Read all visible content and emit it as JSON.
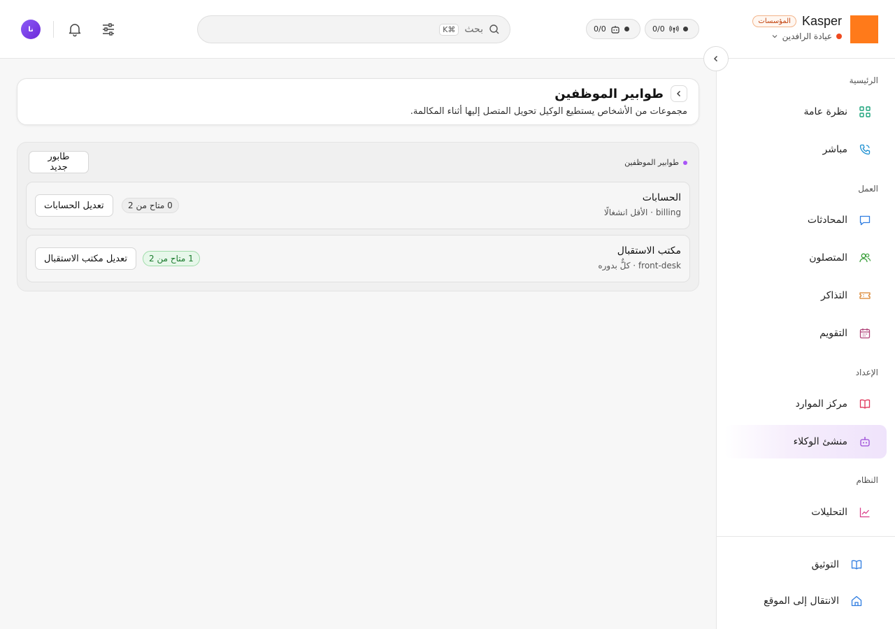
{
  "header": {
    "brand_name": "Kasper",
    "brand_badge": "المؤسسات",
    "workspace": "عيادة الرافدين",
    "pill_calls": "0/0",
    "pill_agents": "0/0",
    "search_placeholder": "بحث",
    "search_shortcut": "⌘K",
    "avatar_initials": "نا",
    "logo_color": "#ff7a1a"
  },
  "sidebar": {
    "sections": [
      {
        "label": "الرئيسية"
      },
      {
        "label": "العمل"
      },
      {
        "label": "الإعداد"
      },
      {
        "label": "النظام"
      }
    ],
    "items": [
      {
        "label": "نظرة عامة",
        "icon": "grid-icon"
      },
      {
        "label": "مباشر",
        "icon": "phone-icon"
      },
      {
        "label": "المحادثات",
        "icon": "chat-icon"
      },
      {
        "label": "المتصلون",
        "icon": "users-icon"
      },
      {
        "label": "التذاكر",
        "icon": "ticket-icon"
      },
      {
        "label": "التقويم",
        "icon": "calendar-icon"
      },
      {
        "label": "مركز الموارد",
        "icon": "book-icon"
      },
      {
        "label": "منشئ الوكلاء",
        "icon": "robot-icon",
        "active": true
      },
      {
        "label": "التحليلات",
        "icon": "chart-icon"
      }
    ],
    "footer": [
      {
        "label": "التوثيق",
        "icon": "docs-icon"
      },
      {
        "label": "الانتقال إلى الموقع",
        "icon": "home-icon"
      }
    ]
  },
  "page": {
    "title": "طوابير الموظفين",
    "description": "مجموعات من الأشخاص يستطيع الوكيل تحويل المتصل إليها أثناء المكالمة."
  },
  "queues": {
    "header_label": "طوابير الموظفين",
    "new_button": "طابور جديد",
    "rows": [
      {
        "name": "الحسابات",
        "slug": "billing",
        "strategy": "· الأقل انشغالًا",
        "capacity": "0 متاح من 2",
        "edit_label": "تعديل الحسابات",
        "status": "gray"
      },
      {
        "name": "مكتب الاستقبال",
        "slug": "front-desk",
        "strategy": "· كلٌّ بدوره",
        "capacity": "1 متاح من 2",
        "edit_label": "تعديل مكتب الاستقبال",
        "status": "green"
      }
    ]
  }
}
